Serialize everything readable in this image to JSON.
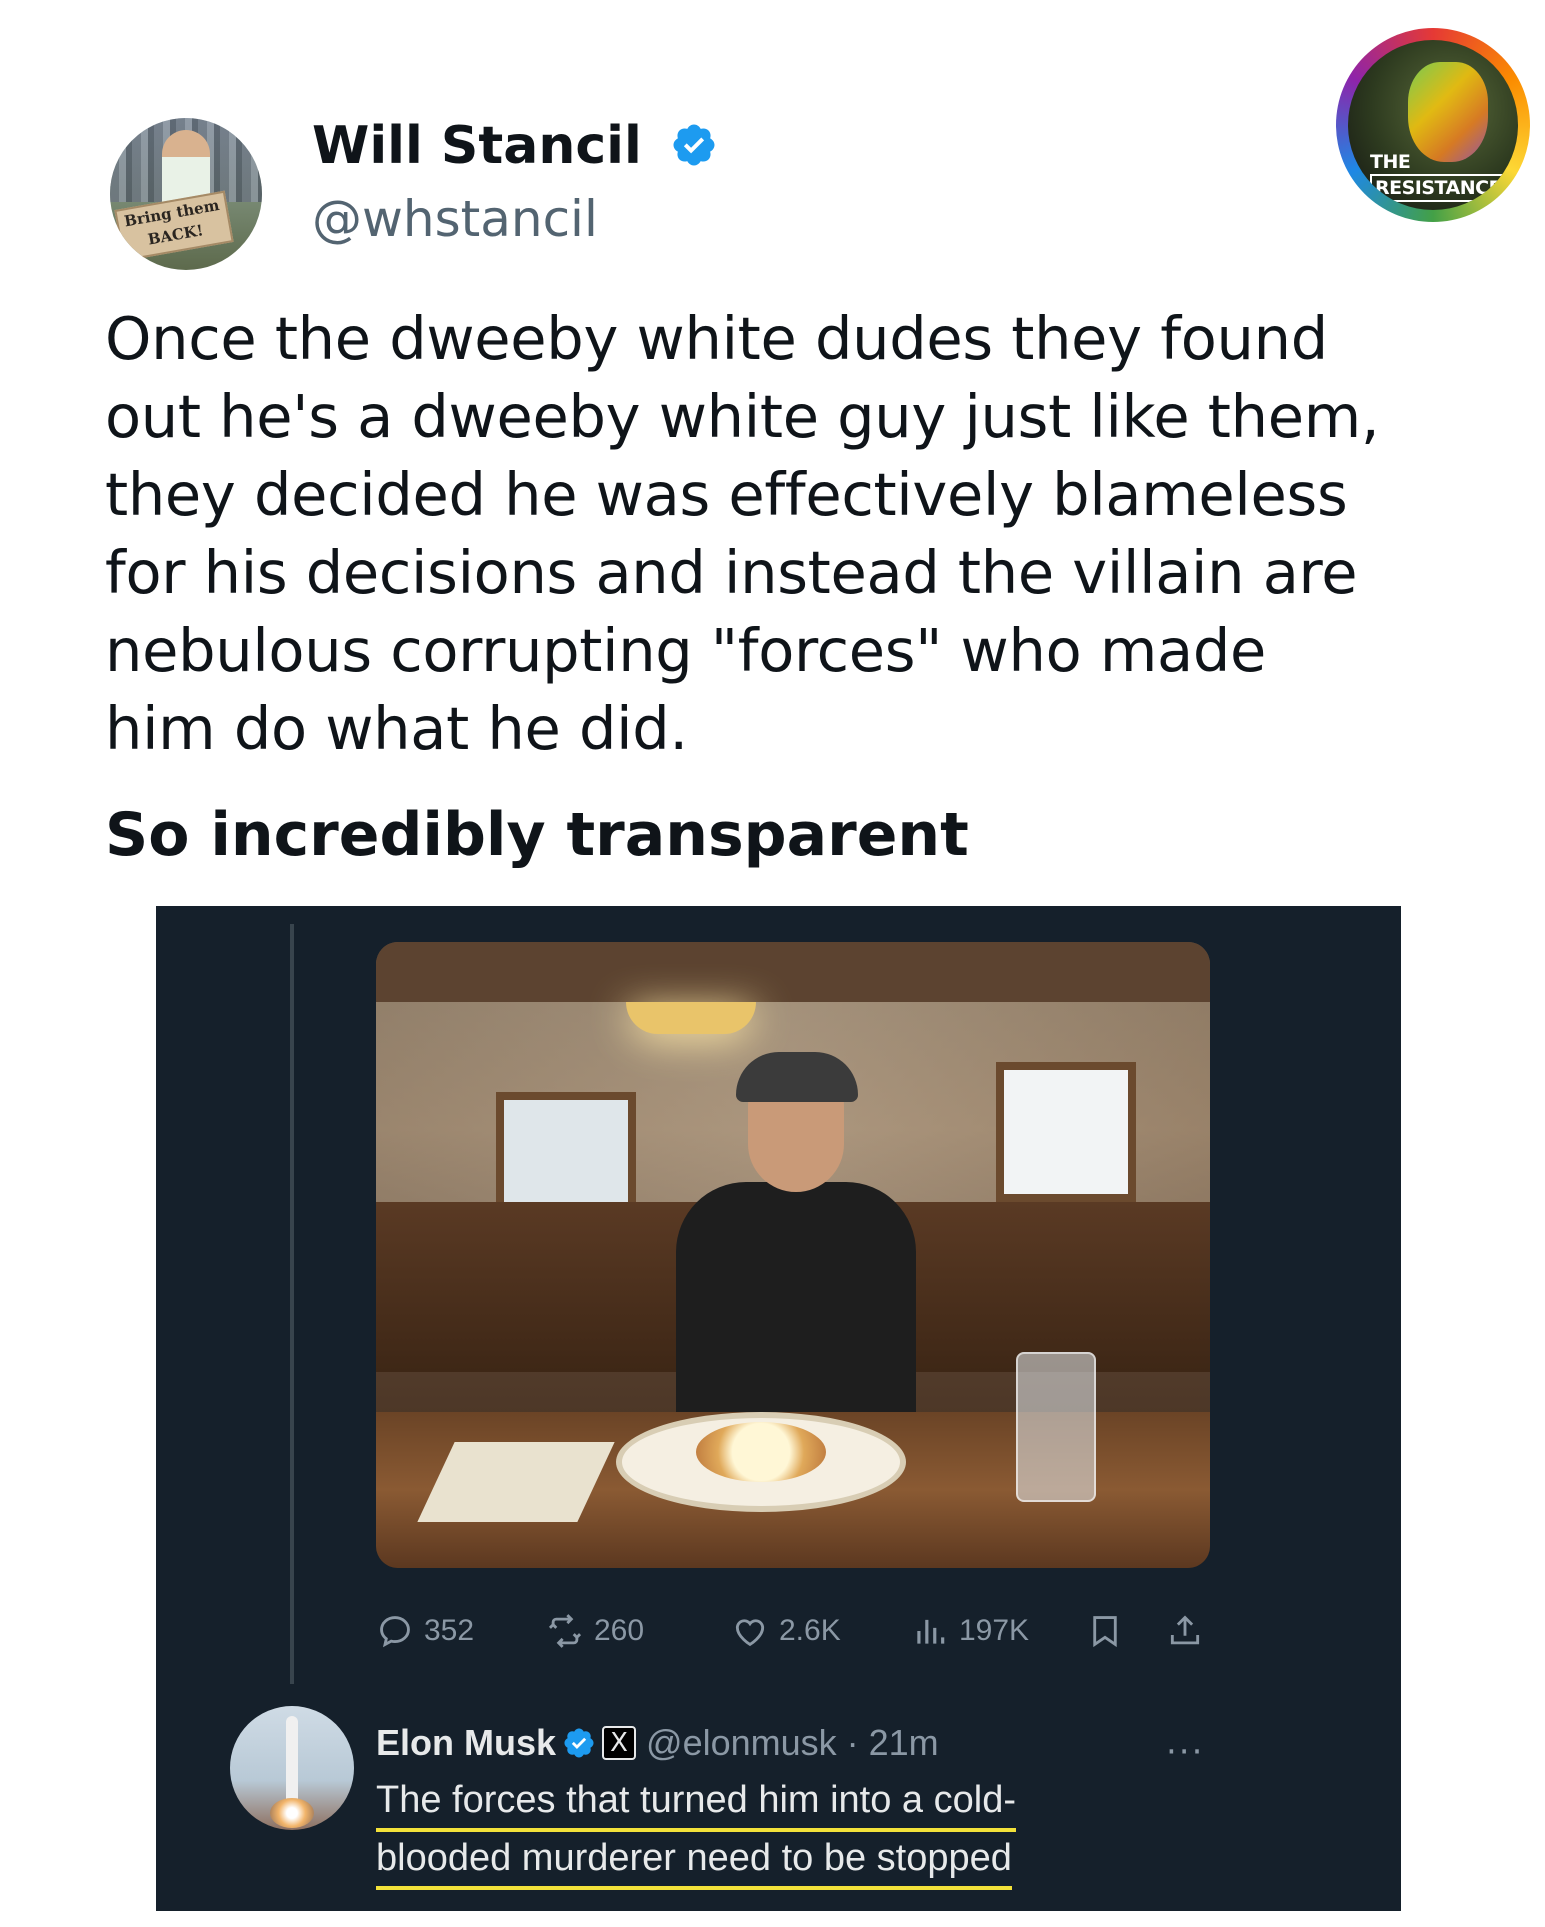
{
  "author": {
    "name": "Will Stancil",
    "handle": "@whstancil",
    "avatar_sign": [
      "Bring them",
      "BACK!"
    ]
  },
  "badge": {
    "line1": "THE",
    "line2": "RESISTANCE"
  },
  "tweet": {
    "lines": [
      "Once the dweeby white dudes they found",
      "out he's a dweeby white guy just like them,",
      "they decided he was effectively blameless",
      "for his decisions and instead the villain are",
      "nebulous corrupting \"forces\" who made",
      "him do what he did."
    ],
    "headline": "So incredibly transparent"
  },
  "embedded_post": {
    "metrics": {
      "replies": "352",
      "reposts": "260",
      "likes": "2.6K",
      "views": "197K"
    },
    "reply": {
      "name": "Elon Musk",
      "x_badge": "X",
      "handle_time": "@elonmusk · 21m",
      "lines": [
        "The forces that turned him into a cold-",
        "blooded murderer need to be stopped"
      ]
    },
    "more_label": "···"
  },
  "colors": {
    "verified": "#1d9bf0",
    "dark_bg": "#15202b",
    "highlight_underline": "#f3e23a"
  }
}
